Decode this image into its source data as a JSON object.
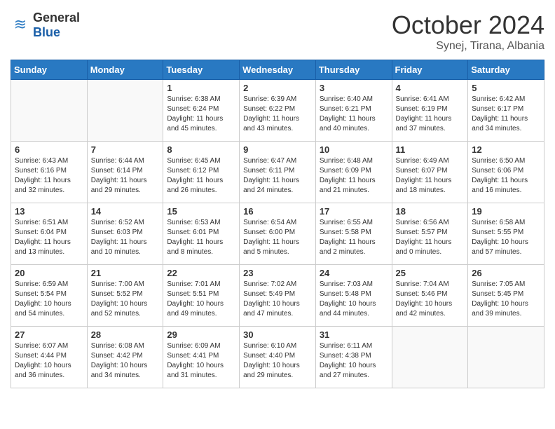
{
  "logo": {
    "general": "General",
    "blue": "Blue"
  },
  "header": {
    "month": "October 2024",
    "location": "Synej, Tirana, Albania"
  },
  "weekdays": [
    "Sunday",
    "Monday",
    "Tuesday",
    "Wednesday",
    "Thursday",
    "Friday",
    "Saturday"
  ],
  "weeks": [
    [
      {
        "day": "",
        "content": ""
      },
      {
        "day": "",
        "content": ""
      },
      {
        "day": "1",
        "content": "Sunrise: 6:38 AM\nSunset: 6:24 PM\nDaylight: 11 hours and 45 minutes."
      },
      {
        "day": "2",
        "content": "Sunrise: 6:39 AM\nSunset: 6:22 PM\nDaylight: 11 hours and 43 minutes."
      },
      {
        "day": "3",
        "content": "Sunrise: 6:40 AM\nSunset: 6:21 PM\nDaylight: 11 hours and 40 minutes."
      },
      {
        "day": "4",
        "content": "Sunrise: 6:41 AM\nSunset: 6:19 PM\nDaylight: 11 hours and 37 minutes."
      },
      {
        "day": "5",
        "content": "Sunrise: 6:42 AM\nSunset: 6:17 PM\nDaylight: 11 hours and 34 minutes."
      }
    ],
    [
      {
        "day": "6",
        "content": "Sunrise: 6:43 AM\nSunset: 6:16 PM\nDaylight: 11 hours and 32 minutes."
      },
      {
        "day": "7",
        "content": "Sunrise: 6:44 AM\nSunset: 6:14 PM\nDaylight: 11 hours and 29 minutes."
      },
      {
        "day": "8",
        "content": "Sunrise: 6:45 AM\nSunset: 6:12 PM\nDaylight: 11 hours and 26 minutes."
      },
      {
        "day": "9",
        "content": "Sunrise: 6:47 AM\nSunset: 6:11 PM\nDaylight: 11 hours and 24 minutes."
      },
      {
        "day": "10",
        "content": "Sunrise: 6:48 AM\nSunset: 6:09 PM\nDaylight: 11 hours and 21 minutes."
      },
      {
        "day": "11",
        "content": "Sunrise: 6:49 AM\nSunset: 6:07 PM\nDaylight: 11 hours and 18 minutes."
      },
      {
        "day": "12",
        "content": "Sunrise: 6:50 AM\nSunset: 6:06 PM\nDaylight: 11 hours and 16 minutes."
      }
    ],
    [
      {
        "day": "13",
        "content": "Sunrise: 6:51 AM\nSunset: 6:04 PM\nDaylight: 11 hours and 13 minutes."
      },
      {
        "day": "14",
        "content": "Sunrise: 6:52 AM\nSunset: 6:03 PM\nDaylight: 11 hours and 10 minutes."
      },
      {
        "day": "15",
        "content": "Sunrise: 6:53 AM\nSunset: 6:01 PM\nDaylight: 11 hours and 8 minutes."
      },
      {
        "day": "16",
        "content": "Sunrise: 6:54 AM\nSunset: 6:00 PM\nDaylight: 11 hours and 5 minutes."
      },
      {
        "day": "17",
        "content": "Sunrise: 6:55 AM\nSunset: 5:58 PM\nDaylight: 11 hours and 2 minutes."
      },
      {
        "day": "18",
        "content": "Sunrise: 6:56 AM\nSunset: 5:57 PM\nDaylight: 11 hours and 0 minutes."
      },
      {
        "day": "19",
        "content": "Sunrise: 6:58 AM\nSunset: 5:55 PM\nDaylight: 10 hours and 57 minutes."
      }
    ],
    [
      {
        "day": "20",
        "content": "Sunrise: 6:59 AM\nSunset: 5:54 PM\nDaylight: 10 hours and 54 minutes."
      },
      {
        "day": "21",
        "content": "Sunrise: 7:00 AM\nSunset: 5:52 PM\nDaylight: 10 hours and 52 minutes."
      },
      {
        "day": "22",
        "content": "Sunrise: 7:01 AM\nSunset: 5:51 PM\nDaylight: 10 hours and 49 minutes."
      },
      {
        "day": "23",
        "content": "Sunrise: 7:02 AM\nSunset: 5:49 PM\nDaylight: 10 hours and 47 minutes."
      },
      {
        "day": "24",
        "content": "Sunrise: 7:03 AM\nSunset: 5:48 PM\nDaylight: 10 hours and 44 minutes."
      },
      {
        "day": "25",
        "content": "Sunrise: 7:04 AM\nSunset: 5:46 PM\nDaylight: 10 hours and 42 minutes."
      },
      {
        "day": "26",
        "content": "Sunrise: 7:05 AM\nSunset: 5:45 PM\nDaylight: 10 hours and 39 minutes."
      }
    ],
    [
      {
        "day": "27",
        "content": "Sunrise: 6:07 AM\nSunset: 4:44 PM\nDaylight: 10 hours and 36 minutes."
      },
      {
        "day": "28",
        "content": "Sunrise: 6:08 AM\nSunset: 4:42 PM\nDaylight: 10 hours and 34 minutes."
      },
      {
        "day": "29",
        "content": "Sunrise: 6:09 AM\nSunset: 4:41 PM\nDaylight: 10 hours and 31 minutes."
      },
      {
        "day": "30",
        "content": "Sunrise: 6:10 AM\nSunset: 4:40 PM\nDaylight: 10 hours and 29 minutes."
      },
      {
        "day": "31",
        "content": "Sunrise: 6:11 AM\nSunset: 4:38 PM\nDaylight: 10 hours and 27 minutes."
      },
      {
        "day": "",
        "content": ""
      },
      {
        "day": "",
        "content": ""
      }
    ]
  ]
}
